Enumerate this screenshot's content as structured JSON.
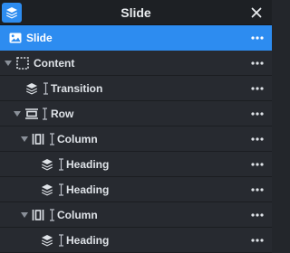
{
  "header": {
    "title": "Slide",
    "layers_icon": "layers-icon",
    "close_icon": "close-icon",
    "accent": "#2d8cf0"
  },
  "tree": {
    "rows": [
      {
        "label": "Slide",
        "icon": "image-icon",
        "selected": true,
        "collapsible": false
      },
      {
        "label": "Content",
        "icon": "dashed-box-icon",
        "collapsible": true,
        "expanded": true
      },
      {
        "label": "Transition",
        "icon": "layers-icon",
        "collapsible": false
      },
      {
        "label": "Row",
        "icon": "row-icon",
        "collapsible": true,
        "expanded": true
      },
      {
        "label": "Column",
        "icon": "column-icon",
        "collapsible": true,
        "expanded": true
      },
      {
        "label": "Heading",
        "icon": "layers-icon",
        "collapsible": false
      },
      {
        "label": "Heading",
        "icon": "layers-icon",
        "collapsible": false
      },
      {
        "label": "Column",
        "icon": "column-icon",
        "collapsible": true,
        "expanded": true
      },
      {
        "label": "Heading",
        "icon": "layers-icon",
        "collapsible": false
      }
    ],
    "more_icon": "more-dots-icon",
    "text_cursor_icon": "text-cursor-icon"
  }
}
